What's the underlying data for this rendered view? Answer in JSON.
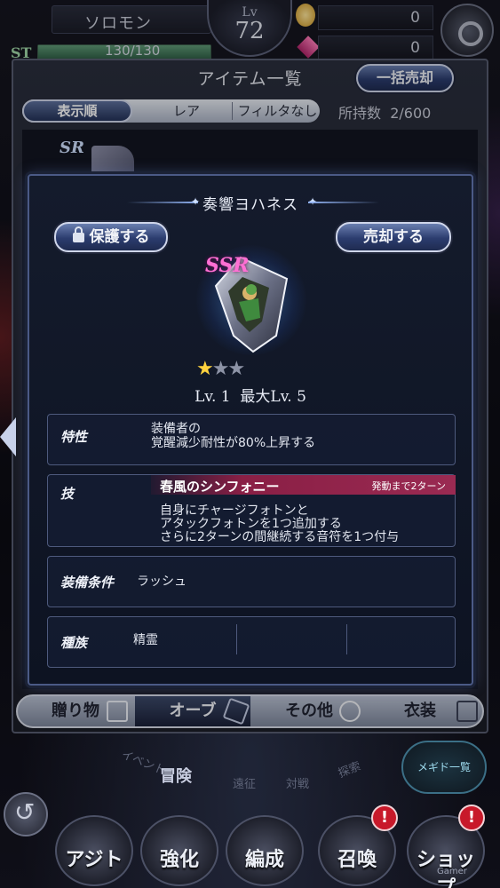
{
  "status": {
    "player_name": "ソロモン",
    "level_label": "Lv",
    "level": "72",
    "st_label": "ST",
    "stamina": "130/130",
    "stamina_fraction": 1.0,
    "coins": "0",
    "gems": "0"
  },
  "item_list": {
    "title": "アイテム一覧",
    "bulk_sell": "一括売却",
    "sort_label": "表示順",
    "sort_value": "レア",
    "filter": "フィルタなし",
    "owned_label": "所持数",
    "owned_count": "2/600",
    "visible_item_rarity": "SR",
    "tabs": [
      {
        "label": "贈り物",
        "icon": "gift-icon",
        "active": false
      },
      {
        "label": "オーブ",
        "icon": "orb-icon",
        "active": true
      },
      {
        "label": "その他",
        "icon": "bag-icon",
        "active": false
      },
      {
        "label": "衣装",
        "icon": "costume-icon",
        "active": false
      }
    ]
  },
  "detail": {
    "name": "奏響ヨハネス",
    "protect": "保護する",
    "sell": "売却する",
    "rarity": "SSR",
    "stars_filled": 1,
    "stars_total": 3,
    "level": "Lv. 1",
    "max_level": "最大Lv. 5",
    "trait_label": "特性",
    "trait_line1": "装備者の",
    "trait_line2": "覚醒減少耐性が80%上昇する",
    "skill_label": "技",
    "skill_name": "春風のシンフォニー",
    "skill_cooldown": "発動まで2ターン",
    "skill_line1": "自身にチャージフォトンと",
    "skill_line2": "アタックフォトンを1つ追加する",
    "skill_line3": "さらに2ターンの間継続する音符を1つ付与",
    "equip_label": "装備条件",
    "equip_value": "ラッシュ",
    "race_label": "種族",
    "race_value": "精霊"
  },
  "bottom_nav": {
    "ring_labels": [
      "イベント",
      "冒険",
      "遠征",
      "対戦",
      "探索"
    ],
    "megido_list": "メギド一覧",
    "buttons": [
      "アジト",
      "強化",
      "編成",
      "召喚",
      "ショップ"
    ],
    "badge_text": "!",
    "watermark": "Gamer"
  },
  "colors": {
    "accent_blue": "#2b3c6e",
    "skill_bar": "#8a1f45",
    "rarity_pink": "#ff6fd4",
    "star_gold": "#ffd23e",
    "badge_red": "#c8192a"
  }
}
